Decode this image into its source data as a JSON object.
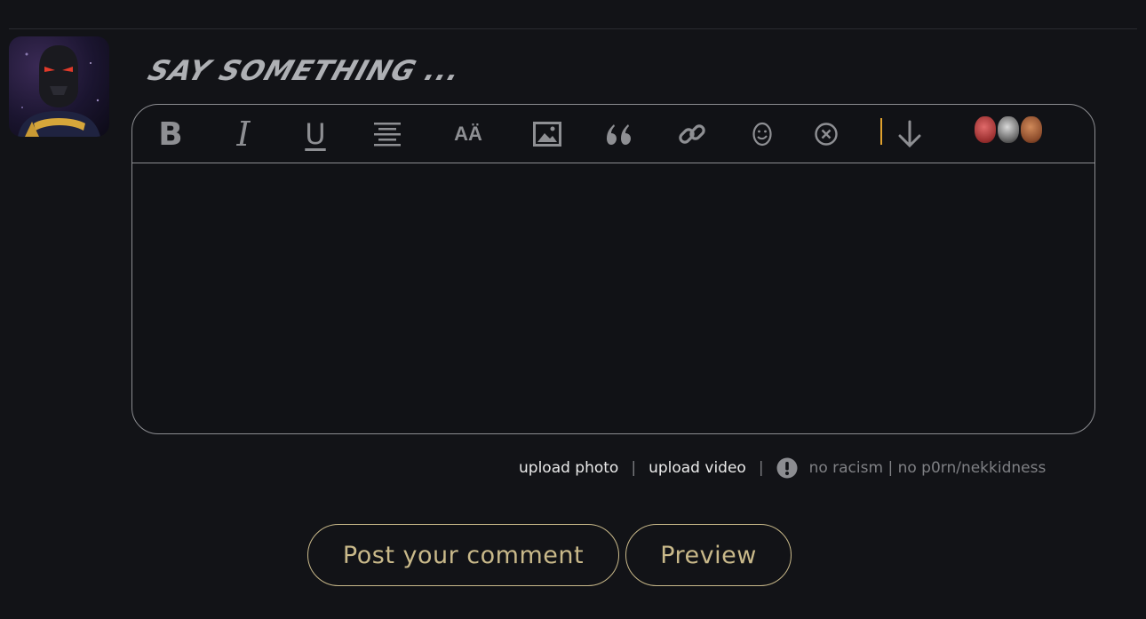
{
  "composer": {
    "heading": "SAY SOMETHING ...",
    "placeholder": "",
    "toolbar": {
      "bold_icon": "bold-icon",
      "bold_glyph": "B",
      "italic_icon": "italic-icon",
      "italic_glyph": "I",
      "underline_icon": "underline-icon",
      "underline_glyph": "U",
      "align_icon": "align-center-icon",
      "fontsize_icon": "font-size-icon",
      "fontsize_glyph": "AÄ",
      "image_icon": "image-icon",
      "quote_icon": "quote-icon",
      "link_icon": "link-icon",
      "emoji_icon": "emoji-icon",
      "clear_icon": "clear-format-icon",
      "divider_color": "#e1a22e",
      "down_icon": "arrow-down-icon",
      "emoji_set_icon": "emoji-faces-icon"
    }
  },
  "meta": {
    "upload_photo": "upload photo",
    "separator": "|",
    "upload_video": "upload video",
    "warning_icon": "exclamation-icon",
    "rules": "no racism | no p0rn/nekkidness"
  },
  "actions": {
    "post_label": "Post your comment",
    "preview_label": "Preview"
  },
  "colors": {
    "background": "#121317",
    "border": "#8c8d91",
    "button_gold": "#c9b98a",
    "heading_gray": "#aeb0b4"
  }
}
